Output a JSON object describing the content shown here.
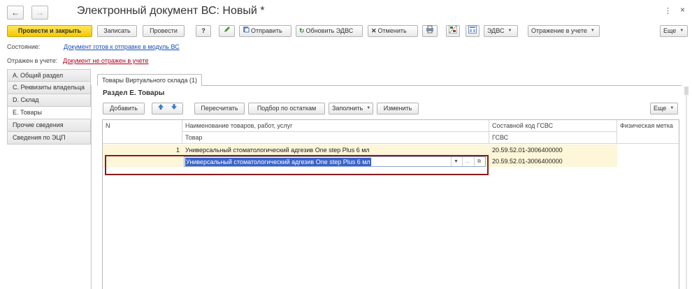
{
  "window": {
    "title": "Электронный документ ВС: Новый *",
    "nav_back": "←",
    "nav_forward": "→",
    "menu_glyph": "⋮",
    "close_glyph": "×"
  },
  "toolbar": {
    "post_close": "Провести и закрыть",
    "save": "Записать",
    "post": "Провести",
    "help": "?",
    "send": "Отправить",
    "refresh_edvs": "Обновить ЭДВС",
    "cancel": "Отменить",
    "edvs": "ЭДВС",
    "reflection": "Отражение в учете",
    "more": "Еще"
  },
  "status": {
    "state_label": "Состояние:",
    "state_link": "Документ готов к отправке в модуль ВС",
    "reflected_label": "Отражен в учете:",
    "reflected_link": "Документ не отражен в учете"
  },
  "sections": [
    {
      "label": "А. Общий раздел"
    },
    {
      "label": "С. Реквизиты владельца"
    },
    {
      "label": "D. Склад"
    },
    {
      "label": "Е. Товары"
    },
    {
      "label": "Прочие сведения"
    },
    {
      "label": "Сведения по ЭЦП"
    }
  ],
  "panel": {
    "tab": "Товары Виртуального склада (1)",
    "section_title": "Раздел Е. Товары",
    "add": "Добавить",
    "recalc": "Пересчитать",
    "pick": "Подбор по остаткам",
    "fill": "Заполнить",
    "change": "Изменить",
    "more": "Еще"
  },
  "table": {
    "headers": {
      "n": "N",
      "name": "Наименование товаров, работ, услуг",
      "product": "Товар",
      "code": "Составной код ГСВС",
      "gsvs": "ГСВС",
      "mark": "Физическая метка"
    },
    "rows": [
      {
        "n": "1",
        "name": "Универсальный стоматологический адгезив One step Plus 6 мл",
        "code": "20.59.52.01-3006400000",
        "product": "Универсальный стоматологический адгезив One step Plus 6 мл",
        "gsvs": "20.59.52.01-3006400000"
      }
    ]
  },
  "colors": {
    "primary_button": "#f5c800",
    "row_highlight": "#fdf6d8",
    "selection": "#3a63c8",
    "link": "#1a4fb5",
    "link_red": "#b00020",
    "focus_frame": "#8b1a1a"
  }
}
